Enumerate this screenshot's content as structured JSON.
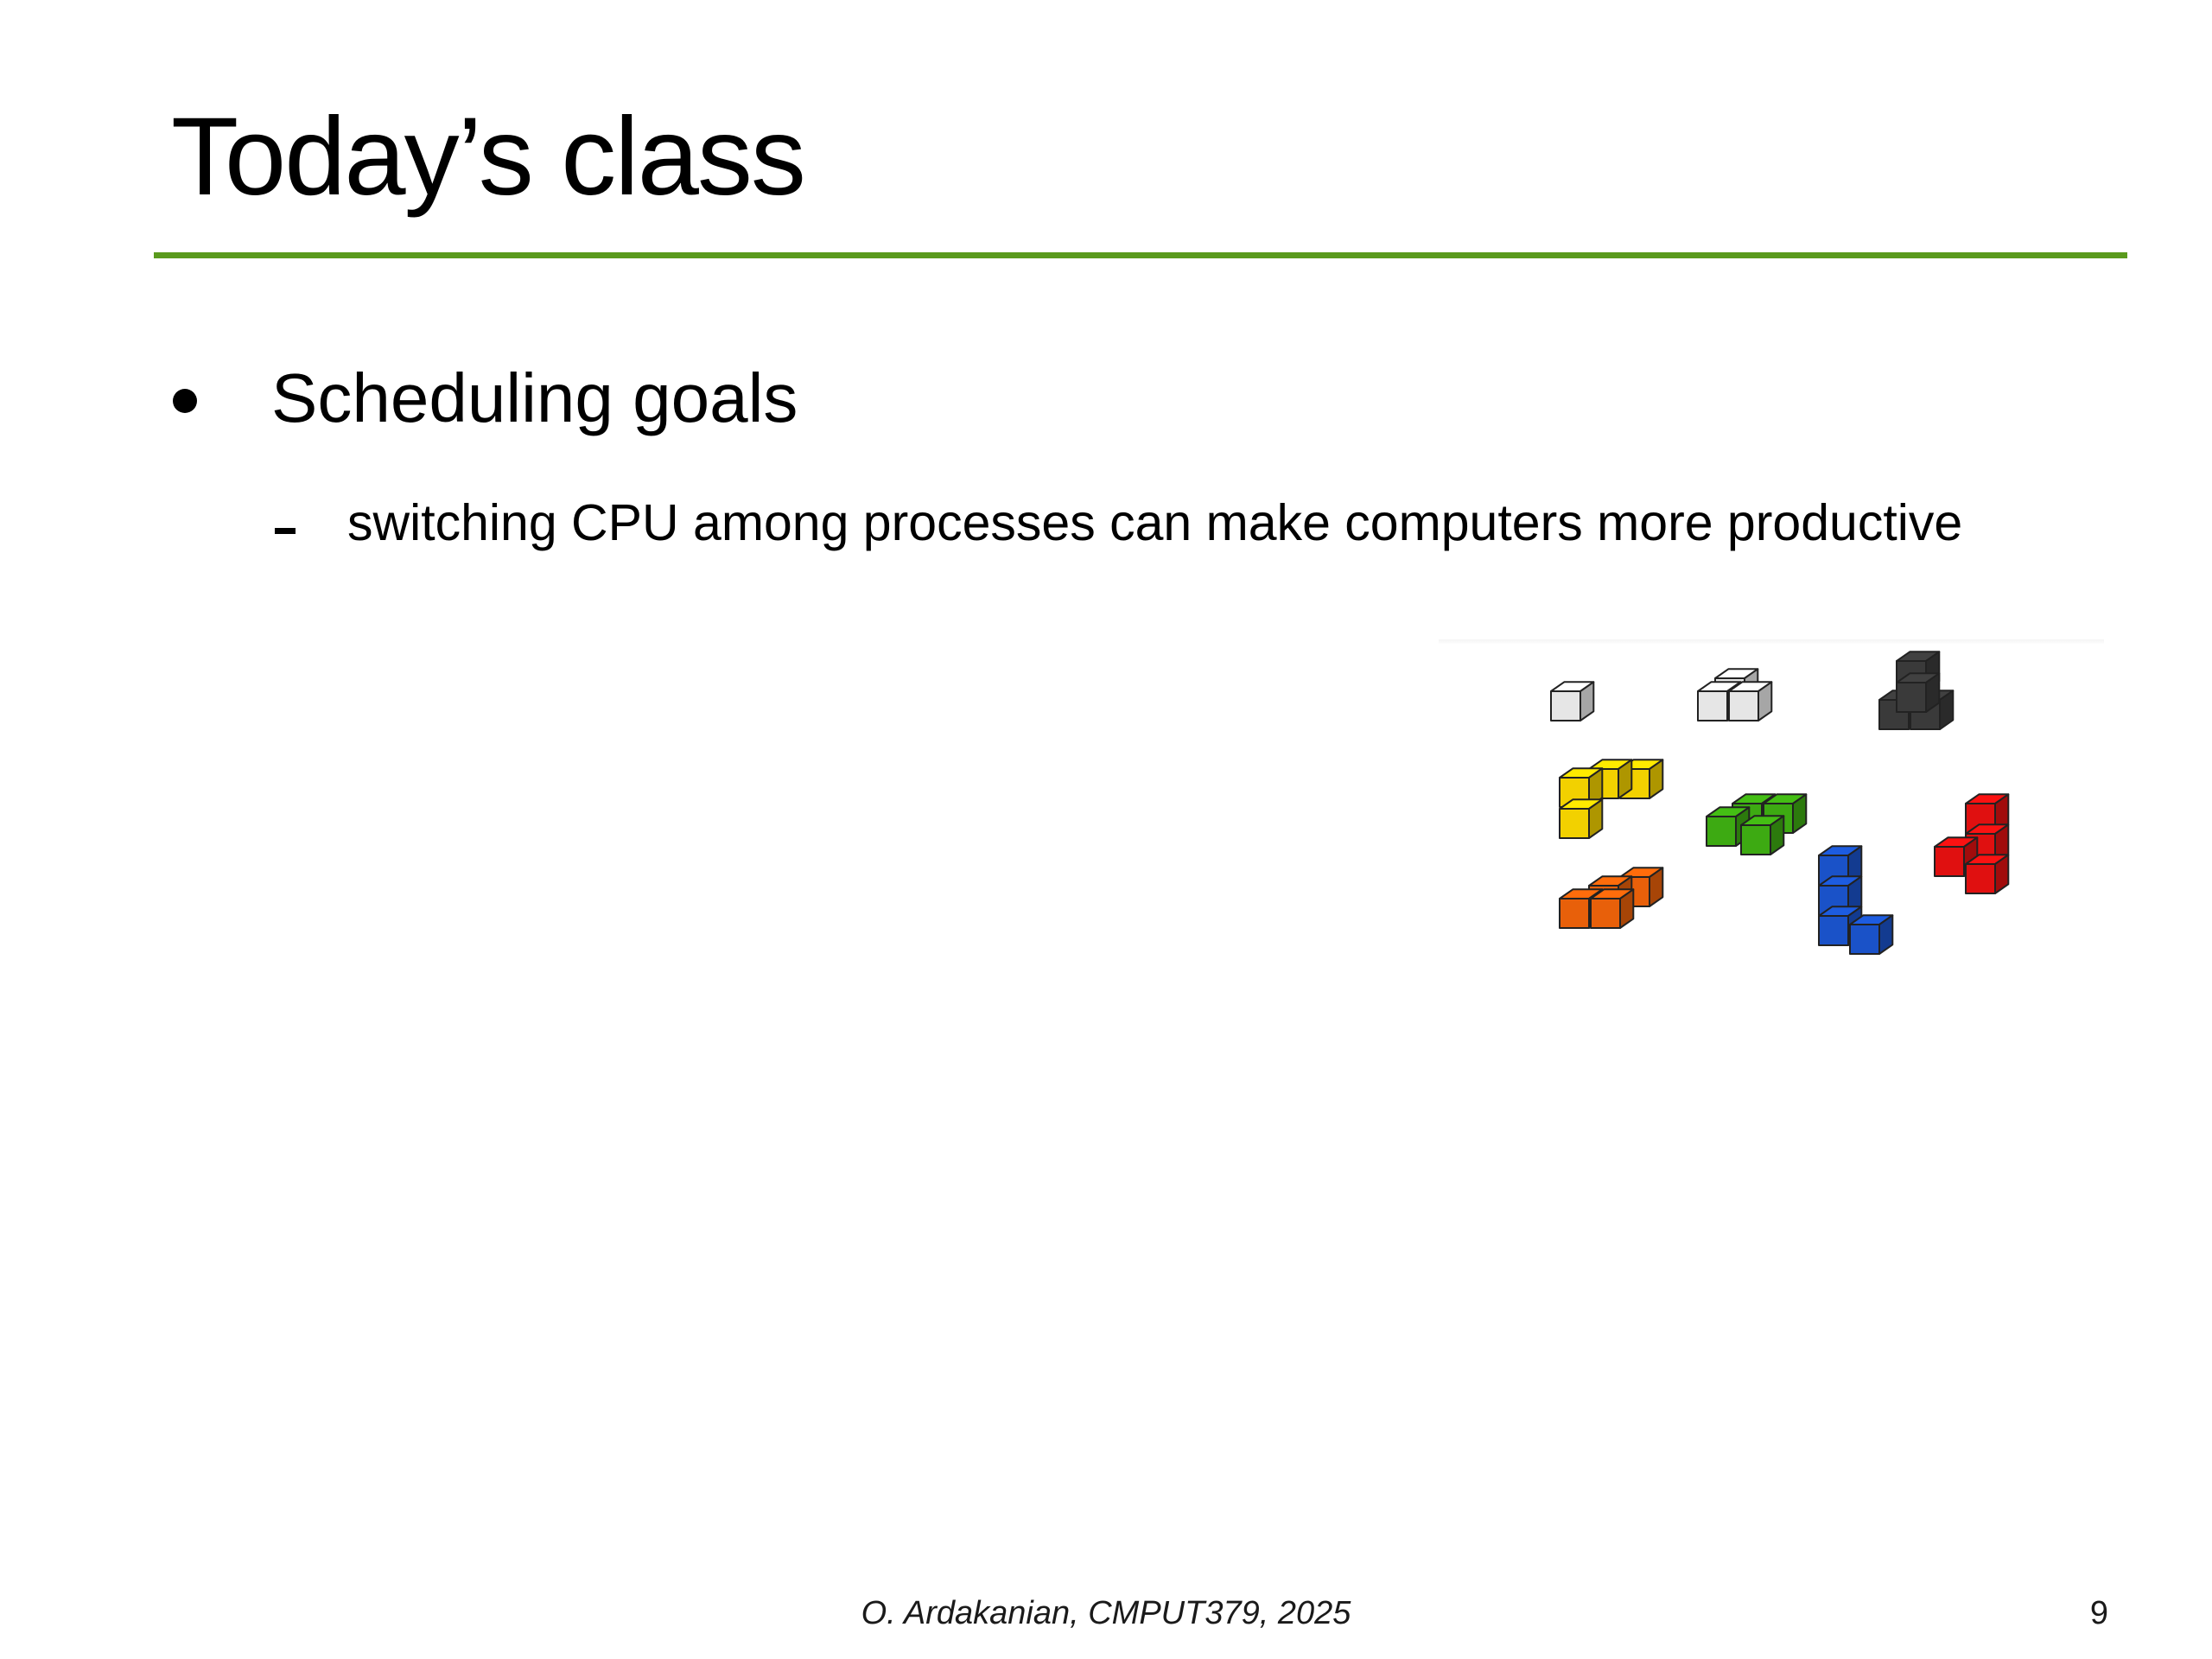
{
  "slide": {
    "title": "Today’s class",
    "accent_color": "#5a9a1d",
    "bullets": [
      {
        "text": "Scheduling goals",
        "sub": [
          {
            "text": "switching CPU among processes can make computers more productive"
          }
        ]
      }
    ],
    "figure": {
      "icon": "tetris-cubes-image",
      "piece_colors": [
        "#e6e6e6",
        "#e6e6e6",
        "#3a3a3a",
        "#f2d100",
        "#3daa12",
        "#e01010",
        "#e8600a",
        "#1a52c8"
      ]
    },
    "footer": "O. Ardakanian, CMPUT379, 2025",
    "page_number": "9"
  }
}
